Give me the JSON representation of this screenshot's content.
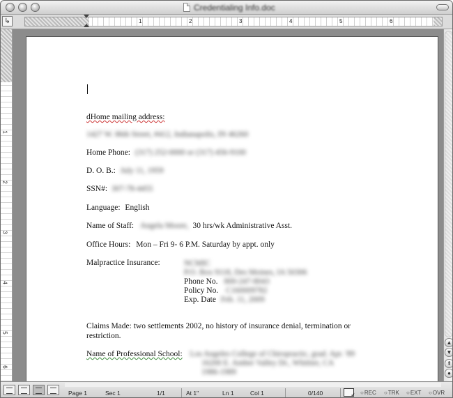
{
  "window": {
    "title": "Credentialing Info.doc"
  },
  "ruler": {
    "tab_selector_glyph": "↳",
    "numbers": [
      "1",
      "2",
      "3",
      "4",
      "5",
      "6"
    ]
  },
  "vruler": {
    "numbers": [
      "1",
      "2",
      "3",
      "4",
      "5",
      "6"
    ]
  },
  "document": {
    "home_label": "dHome mailing address:",
    "home_address_redacted": "1427 W. 86th Street, #412, Indianapolis, IN 46260",
    "home_phone_label": "Home Phone:",
    "home_phone_redacted": "(317) 252-0000 or (317) 456-9100",
    "dob_label": "D. O. B.:",
    "dob_redacted": "July 11, 1959",
    "ssn_label": "SSN#:",
    "ssn_redacted": "307-78-4455",
    "language_label": "Language:",
    "language_value": "English",
    "staff_label": "Name of Staff:",
    "staff_name_redacted": "Angela Moore,",
    "staff_role": "30 hrs/wk  Administrative  Asst.",
    "office_hours_label": "Office Hours:",
    "office_hours_value": "Mon – Fri   9- 6 P.M.  Saturday by appt. only",
    "malpractice_label": "Malpractice Insurance:",
    "insurer_name_redacted": "NCMIC",
    "insurer_address_redacted": "P.O. Box 9118, Des Moines, IA 50306",
    "phone_no_label": "Phone No.",
    "phone_no_redacted": "800-247-8043",
    "policy_no_label": "Policy No.",
    "policy_no_redacted": "C160009782",
    "exp_date_label": "Exp. Date",
    "exp_date_redacted": "Feb. 11, 2009",
    "claims_line1": "Claims Made:  two settlements 2002, no history of insurance denial, termination or",
    "claims_line2": "restriction.",
    "school_label": "Name of Professional School:",
    "school_line1_redacted": "Los Angeles College of Chiropractic,  grad. Apr. '89",
    "school_line2_redacted": "16200 E. Amber Valley Dr., Whittier, CA",
    "school_line3_redacted": "1986-1989"
  },
  "statusbar": {
    "page": "Page  1",
    "sec": "Sec  1",
    "page_of": "1/1",
    "at": "At  1\"",
    "ln": "Ln  1",
    "col": "Col  1",
    "words": "0/140",
    "rec": "REC",
    "trk": "TRK",
    "ext": "EXT",
    "ovr": "OVR"
  }
}
